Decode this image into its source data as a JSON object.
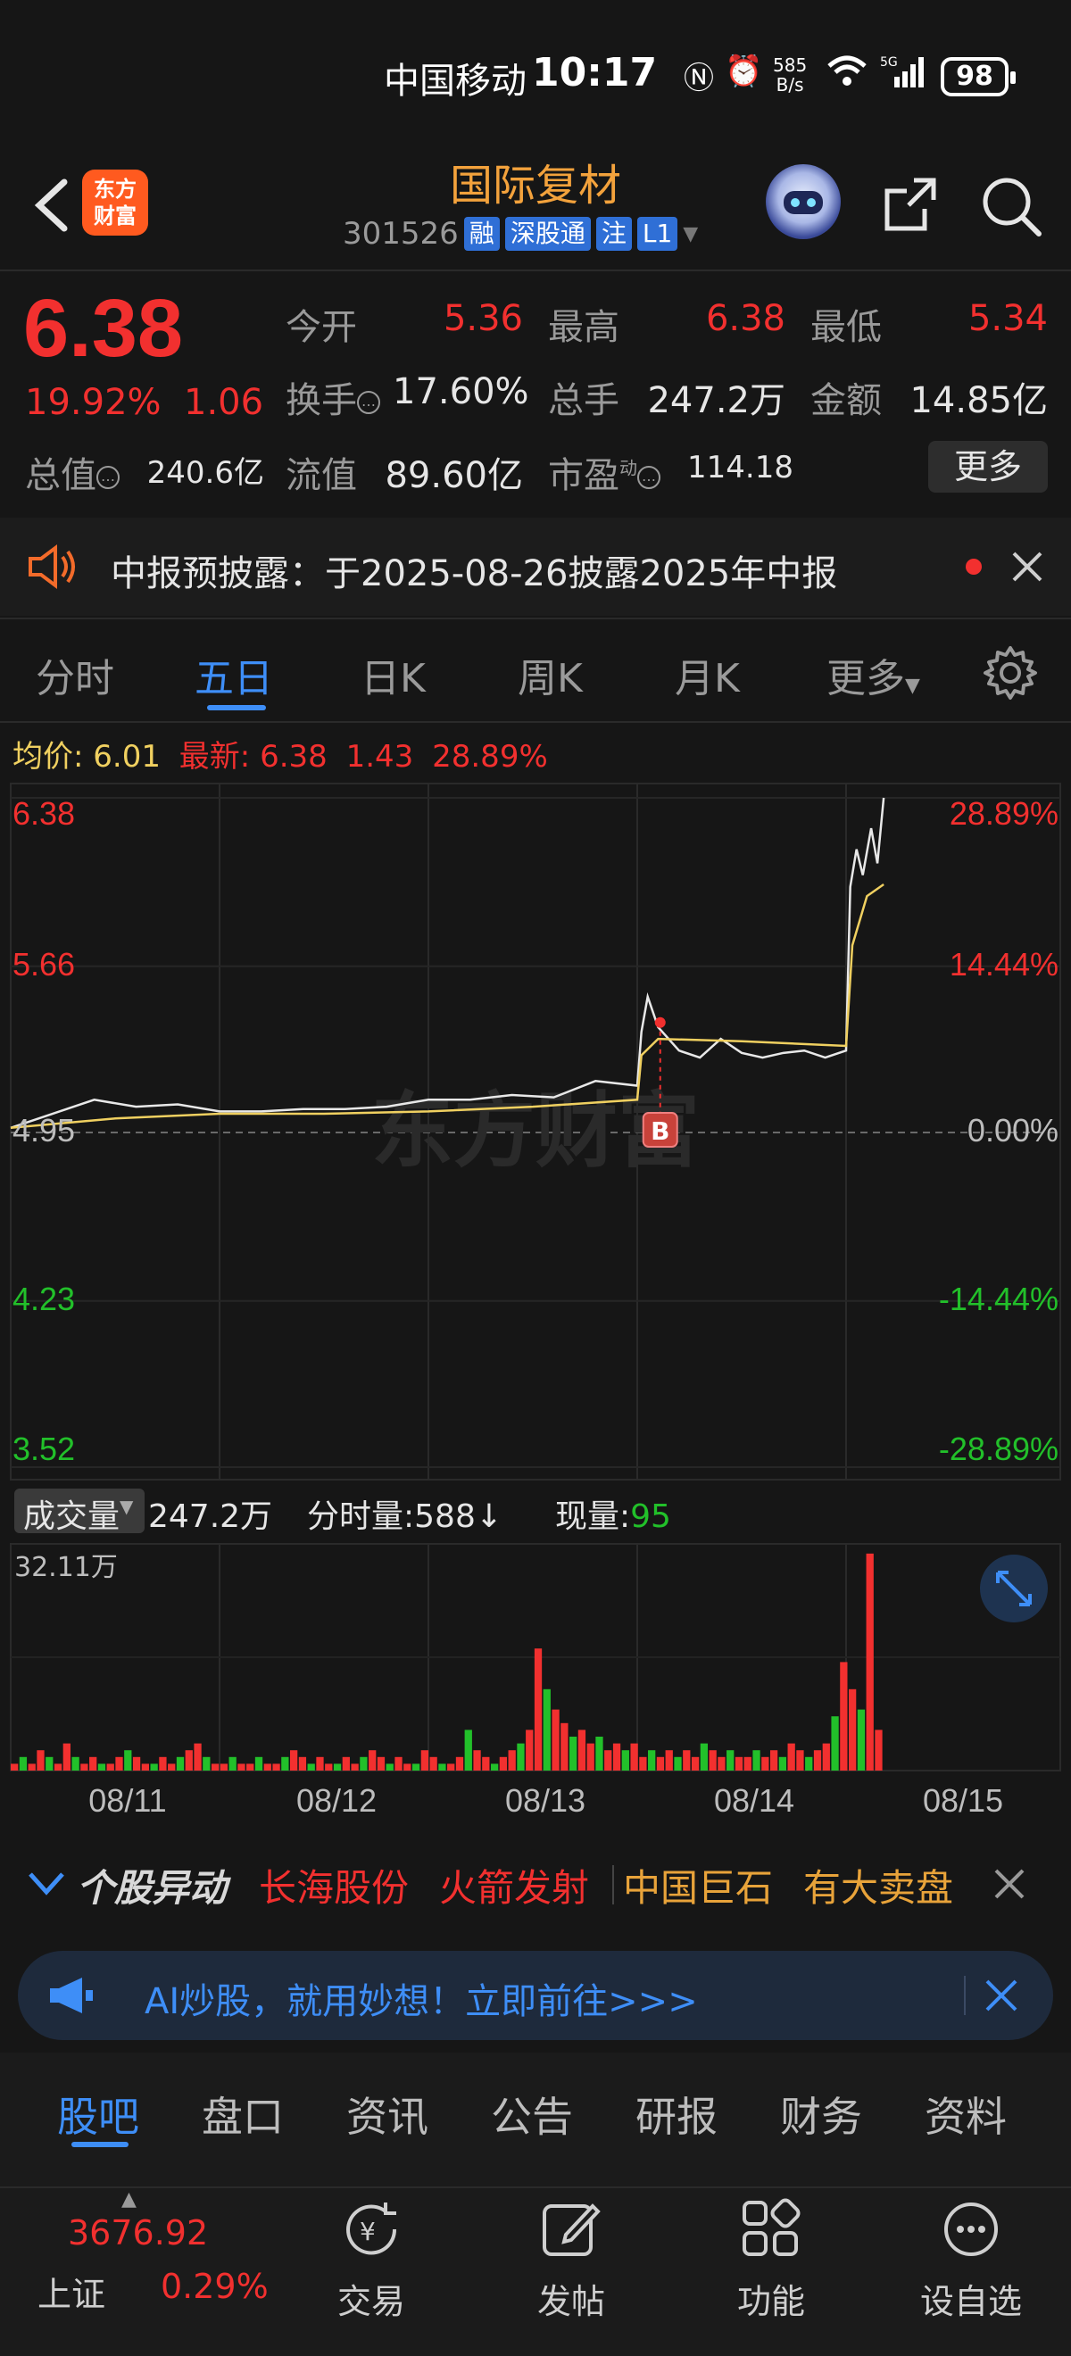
{
  "status_bar": {
    "carrier": "中国移动",
    "time": "10:17",
    "net_speed_top": "585",
    "net_speed_unit": "B/s",
    "battery": "98"
  },
  "header": {
    "logo_line1": "东方",
    "logo_line2": "财富",
    "stock_name": "国际复材",
    "stock_code": "301526",
    "tags": [
      "融",
      "深股通",
      "注",
      "L1"
    ]
  },
  "quote": {
    "price": "6.38",
    "change_pct": "19.92%",
    "change": "1.06",
    "open_label": "今开",
    "open": "5.36",
    "high_label": "最高",
    "high": "6.38",
    "low_label": "最低",
    "low": "5.34",
    "turnover_label": "换手",
    "turnover": "17.60%",
    "volume_label": "总手",
    "volume": "247.2万",
    "amount_label": "金额",
    "amount": "14.85亿",
    "mktcap_label": "总值",
    "mktcap": "240.6亿",
    "float_label": "流值",
    "float": "89.60亿",
    "pe_label": "市盈",
    "pe_sup": "动",
    "pe": "114.18",
    "more_button": "更多"
  },
  "notice": {
    "text": "中报预披露：于2025-08-26披露2025年中报"
  },
  "chart_tabs": [
    "分时",
    "五日",
    "日K",
    "周K",
    "月K",
    "更多"
  ],
  "chart_tab_active": "五日",
  "chart_header": {
    "avg_label": "均价:",
    "avg_value": "6.01",
    "latest_label": "最新:",
    "latest_price": "6.38",
    "latest_change": "1.43",
    "latest_pct": "28.89%"
  },
  "chart_data": {
    "type": "line",
    "title": "",
    "x_labels": [
      "08/11",
      "08/12",
      "08/13",
      "08/14",
      "08/15"
    ],
    "y_left_ticks": [
      "6.38",
      "5.66",
      "4.95",
      "4.23",
      "3.52"
    ],
    "y_right_ticks": [
      "28.89%",
      "14.44%",
      "0.00%",
      "-14.44%",
      "-28.89%"
    ],
    "ylim": [
      3.52,
      6.38
    ],
    "baseline": 4.95,
    "series": [
      {
        "name": "",
        "color": "#e8e8e8",
        "x": [
          0,
          0.2,
          0.4,
          0.6,
          0.8,
          1.0,
          1.2,
          1.4,
          1.6,
          1.8,
          2.0,
          2.2,
          2.4,
          2.6,
          2.8,
          3.0,
          3.02,
          3.05,
          3.1,
          3.2,
          3.3,
          3.4,
          3.5,
          3.6,
          3.7,
          3.8,
          3.9,
          4.0,
          4.02,
          4.05,
          4.08,
          4.12,
          4.15,
          4.18
        ],
        "values": [
          4.97,
          5.03,
          5.09,
          5.06,
          5.07,
          5.04,
          5.04,
          5.05,
          5.05,
          5.06,
          5.09,
          5.09,
          5.11,
          5.1,
          5.17,
          5.15,
          5.38,
          5.53,
          5.4,
          5.3,
          5.27,
          5.35,
          5.29,
          5.27,
          5.29,
          5.3,
          5.27,
          5.3,
          6.0,
          6.16,
          6.05,
          6.25,
          6.1,
          6.38
        ]
      },
      {
        "name": "",
        "color": "#f0d060",
        "x": [
          0,
          0.5,
          1.0,
          1.5,
          2.0,
          2.5,
          3.0,
          3.02,
          3.1,
          3.5,
          4.0,
          4.03,
          4.1,
          4.18
        ],
        "values": [
          4.97,
          5.01,
          5.03,
          5.03,
          5.04,
          5.06,
          5.09,
          5.28,
          5.35,
          5.34,
          5.32,
          5.75,
          5.96,
          6.01
        ]
      }
    ],
    "annotation": {
      "label": "B",
      "x": 3.11,
      "price": 5.42
    },
    "volume": {
      "header_label": "成交量",
      "total": "247.2万",
      "minute_label": "分时量:",
      "minute_value": "588",
      "current_label": "现量:",
      "current_value": "95",
      "max_label": "32.11万",
      "max": 32.11,
      "bars": [
        1,
        2,
        1,
        3,
        2,
        1,
        4,
        2,
        1,
        2,
        1,
        1,
        2,
        3,
        2,
        1,
        1,
        2,
        1,
        2,
        3,
        4,
        2,
        1,
        1,
        2,
        1,
        1,
        2,
        1,
        1,
        2,
        3,
        2,
        1,
        2,
        1,
        1,
        2,
        1,
        2,
        3,
        2,
        1,
        2,
        1,
        1,
        3,
        2,
        1,
        1,
        2,
        6,
        3,
        2,
        1,
        2,
        3,
        4,
        6,
        18,
        12,
        9,
        7,
        5,
        6,
        4,
        5,
        3,
        4,
        3,
        4,
        2,
        3,
        2,
        3,
        2,
        3,
        2,
        4,
        3,
        2,
        3,
        2,
        2,
        3,
        2,
        3,
        2,
        4,
        3,
        2,
        3,
        4,
        8,
        16,
        12,
        9,
        32,
        6
      ]
    }
  },
  "ticker": {
    "title": "个股异动",
    "items": [
      {
        "text": "长海股份",
        "color": "#f2302f"
      },
      {
        "text": "火箭发射",
        "color": "#f2302f"
      },
      {
        "text": "中国巨石",
        "color": "#e8a33a"
      },
      {
        "text": "有大卖盘",
        "color": "#e8a33a"
      }
    ]
  },
  "ai_banner": {
    "text": "AI炒股，就用妙想！立即前往>>>"
  },
  "sub_tabs": [
    "股吧",
    "盘口",
    "资讯",
    "公告",
    "研报",
    "财务",
    "资料"
  ],
  "sub_tab_active": "股吧",
  "bottom_nav": {
    "index_value": "3676.92",
    "index_name": "上证",
    "index_pct": "0.29%",
    "items": [
      "交易",
      "发帖",
      "功能",
      "设自选"
    ]
  },
  "colors": {
    "up": "#f2302f",
    "down": "#22c02a",
    "accent": "#3e8ef7",
    "brand": "#ff5a1f"
  }
}
